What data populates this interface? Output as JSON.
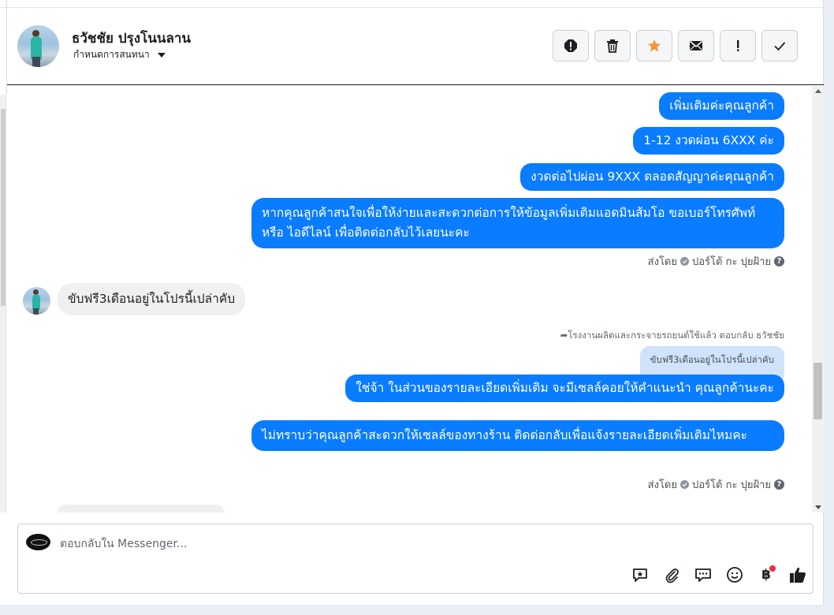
{
  "header": {
    "contact_name": "ธวัชชัย ปรุงโนนลาน",
    "assign_label": "กำหนดการสนทนา",
    "actions": [
      {
        "name": "report-spam-icon"
      },
      {
        "name": "trash-icon"
      },
      {
        "name": "star-icon"
      },
      {
        "name": "mark-unread-icon"
      },
      {
        "name": "follow-up-icon"
      },
      {
        "name": "mark-done-icon"
      }
    ],
    "star_color": "#f7923b"
  },
  "thread": {
    "outgoing_group_1": [
      "เพิ่มเติมค่ะคุณลูกค้า",
      "1-12 งวดผ่อน 6XXX ค่ะ",
      "งวดต่อไปผ่อน 9XXX ตลอดสัญญาค่ะคุณลูกค้า",
      "หากคุณลูกค้าสนใจเพื่อให้ง่ายและสะดวกต่อการให้ข้อมูลเพิ่มเติมแอดมินส้มโอ ขอเบอร์โทรศัพท์ หรือ ไอดีไลน์ เพื่อติดต่อกลับไว้เลยนะคะ"
    ],
    "sent_by_1": {
      "prefix": "ส่งโดย",
      "agent": "ปอร์โต้ กะ ปุยฝ้าย"
    },
    "incoming_1": "ขับฟรี3เดือนอยู่ในโปรนี้เปล่าคับ",
    "reply_note": "โรงงานผลิตและกระจายรถยนต์ใช้แล้ว ตอบกลับ ธวัชชัย",
    "quoted_text": "ขับฟรี3เดือนอยู่ในโปรนี้เปล่าคับ",
    "outgoing_group_2": [
      "ใช่จ้า ในส่วนของรายละเอียดเพิ่มเติม จะมีเซลล์คอยให้คำแนะนำ คุณลูกค้านะคะ",
      "ไม่ทราบว่าคุณลูกค้าสะดวกให้เซลล์ของทางร้าน ติดต่อกลับเพื่อแจ้งรายละเอียดเพิ่มเติมไหมคะ"
    ],
    "sent_by_2": {
      "prefix": "ส่งโดย",
      "agent": "ปอร์โต้ กะ ปุยฝ้าย"
    },
    "bubble_color": "#0a7cff"
  },
  "composer": {
    "placeholder": "ตอบกลับใน Messenger...",
    "tools": [
      "saved-reply-icon",
      "attachment-icon",
      "faq-icon",
      "emoji-icon",
      "payment-baht-icon",
      "like-icon"
    ],
    "baht_symbol": "฿"
  }
}
